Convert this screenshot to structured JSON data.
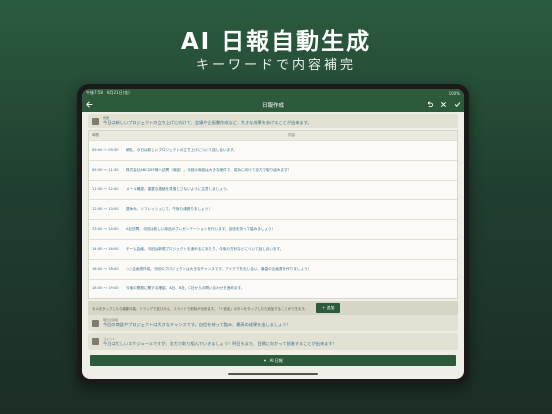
{
  "hero": {
    "title": "AI 日報自動生成",
    "subtitle": "キーワードで内容補完"
  },
  "statusbar": {
    "left": "午後7:58　8月21日(金)",
    "right": "100%"
  },
  "navbar": {
    "title": "日報作成",
    "back_icon": "back-arrow-icon",
    "actions": [
      "undo-icon",
      "close-icon",
      "check-icon"
    ]
  },
  "summary_card": {
    "label": "概要",
    "text": "今日は新しいプロジェクトの立ち上げに向けて、会議や企画書作成など、大きな成果をあげることが出来ます。"
  },
  "schedule": {
    "columns": [
      "時間",
      "内容"
    ],
    "rows": [
      {
        "time": "09:00 〜 09:30",
        "text": "朝礼。今日は新しいプロジェクトの立ち上げについて話し合います。"
      },
      {
        "time": "09:30 〜 11:30",
        "text": "株式会社ABCDEF様へ訪問（商談）。今回の商談は大きな案件で、成功に向けて全力で取り組みます！"
      },
      {
        "time": "11:30 〜 12:00",
        "text": "メール確認。重要な連絡を見落とさないように注意しましょう。"
      },
      {
        "time": "12:00 〜 13:00",
        "text": "昼休み。リフレッシュして、午後も頑張りましょう！"
      },
      {
        "time": "13:00 〜 14:00",
        "text": "A社訪問。今回は新しい商品のプレゼンテーションを行います。自信を持って臨みましょう！"
      },
      {
        "time": "14:00 〜 16:00",
        "text": "チーム会議。今回は新規プロジェクトを進めるにあたり、今後の方針などについて話し合います。"
      },
      {
        "time": "16:00 〜 18:00",
        "text": "○○企画書作成。今回のプロジェクトは大きなチャンスです。アイデアを出し合い、最高の企画書を作りましょう！"
      },
      {
        "time": "18:00 〜 19:00",
        "text": "今後の業務に関する確認。A社、B社、C社からの問い合わせを進めます。"
      }
    ]
  },
  "hint": {
    "text": "セルをタップしたら編集可能、ドラッグで並びかえ、スライドで削除が出来ます。「+追加」ボタンをタップしたら追加することができます。",
    "add_label": "＋ 追加"
  },
  "reflection_card": {
    "label": "明日の目標",
    "text": "今回の商談やプロジェクトは大きなチャンスです。自信を持って臨み、最高の成果を出しましょう！"
  },
  "comment_card": {
    "label": "コメント",
    "text": "今日は忙しいスケジュールですが、全力で取り組んでいきましょう！明日もまた、目標に向かって前進することが出来ます！"
  },
  "ai_button": {
    "label": "AI 日報"
  },
  "colors": {
    "brand_green": "#2d5a3a",
    "text_blue": "#3a6f8f",
    "card_beige": "#e3e1d4"
  }
}
